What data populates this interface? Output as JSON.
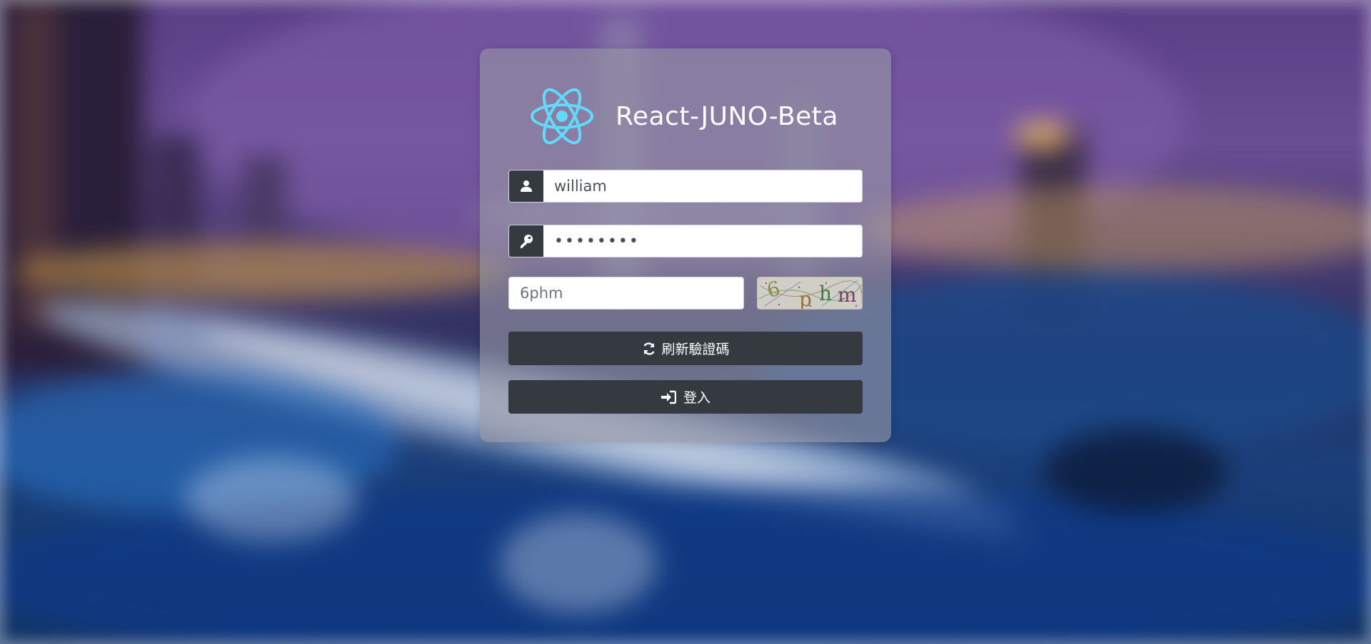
{
  "app": {
    "title": "React-JUNO-Beta"
  },
  "login_form": {
    "username_value": "william",
    "password_value": "••••••••",
    "captcha_value": "6phm",
    "captcha_image_text": "6phm",
    "refresh_label": "刷新驗證碼",
    "login_label": "登入"
  },
  "icons": {
    "logo": "react-atom-logo",
    "username": "user-icon",
    "password": "key-icon",
    "refresh": "refresh-icon",
    "login": "sign-in-icon"
  },
  "colors": {
    "accent_logo": "#61dafb",
    "button_dark": "#343a40",
    "card_bg": "rgba(150,150,165,0.62)"
  }
}
